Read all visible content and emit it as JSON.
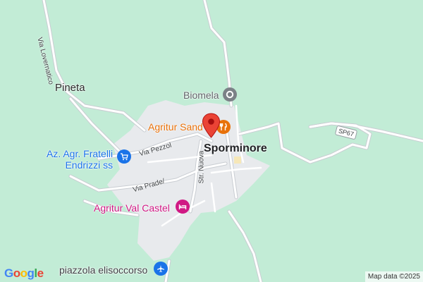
{
  "map": {
    "colors": {
      "land": "#c2ecd6",
      "town": "#e8eaed",
      "road": "#ffffff",
      "road_edge": "#c9cdd2",
      "pin": "#ea4335",
      "poi_orange": "#e8710a",
      "poi_blue": "#1a73e8",
      "poi_pink": "#d01884",
      "poi_gray": "#5f6368"
    },
    "places": {
      "pineta": "Pineta",
      "biomela": "Biomela",
      "agritur_sand": "Agritur Sand",
      "sporminore": "Sporminore",
      "az_agr_line1": "Az. Agr. Fratelli",
      "az_agr_line2": "Endrizzi ss",
      "agritur_val_castel": "Agritur Val Castel",
      "piazzola": "piazzola elisoccorso"
    },
    "roads": {
      "via_lovernatico": "Via Lovernatico",
      "via_pezzol": "Via Pezzol",
      "str_nuova": "Str. Nuova",
      "via_prade": "Via Prade/",
      "sp67": "SP67"
    },
    "icons": {
      "biomela": "location-icon",
      "agritur_sand": "restaurant-icon",
      "az_agr": "shopping-cart-icon",
      "val_castel": "hotel-bed-icon",
      "piazzola": "airport-icon",
      "pin": "map-pin-icon"
    },
    "branding": {
      "logo_letters": [
        "G",
        "o",
        "o",
        "g",
        "l",
        "e"
      ],
      "logo_colors": [
        "#4285f4",
        "#ea4335",
        "#fbbc05",
        "#4285f4",
        "#34a853",
        "#ea4335"
      ],
      "attribution": "Map data ©2025"
    }
  }
}
